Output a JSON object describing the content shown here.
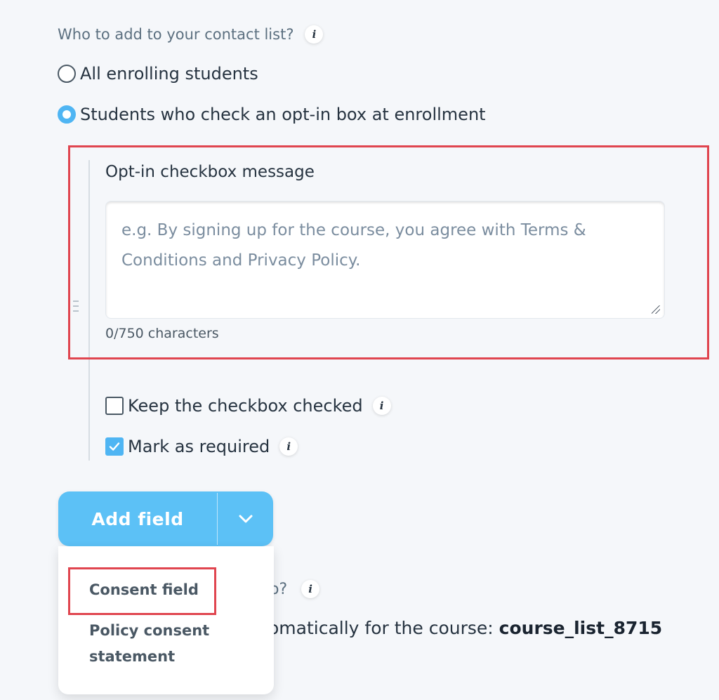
{
  "question": {
    "text": "Who to add to your contact list?",
    "info_glyph": "i"
  },
  "radios": [
    {
      "label": "All enrolling students",
      "selected": false
    },
    {
      "label": "Students who check an opt-in box at enrollment",
      "selected": true
    }
  ],
  "optin": {
    "label": "Opt-in checkbox message",
    "placeholder": "e.g. By signing up for the course, you agree with Terms & Conditions and Privacy Policy.",
    "char_count": "0/750 characters"
  },
  "checkboxes": [
    {
      "label": "Keep the checkbox checked",
      "checked": false
    },
    {
      "label": "Mark as required",
      "checked": true
    }
  ],
  "add_field": {
    "label": "Add field",
    "toggle_icon": "chevron-down-icon"
  },
  "menu": {
    "items": [
      "Consent field",
      "Policy consent statement"
    ]
  },
  "background": {
    "question_fragment": "o?",
    "line_fragment": "omatically for the course: ",
    "list_name": "course_list_8715"
  },
  "colors": {
    "accent": "#5cc1f6",
    "highlight": "#e0454f",
    "background": "#f5f7fa"
  }
}
